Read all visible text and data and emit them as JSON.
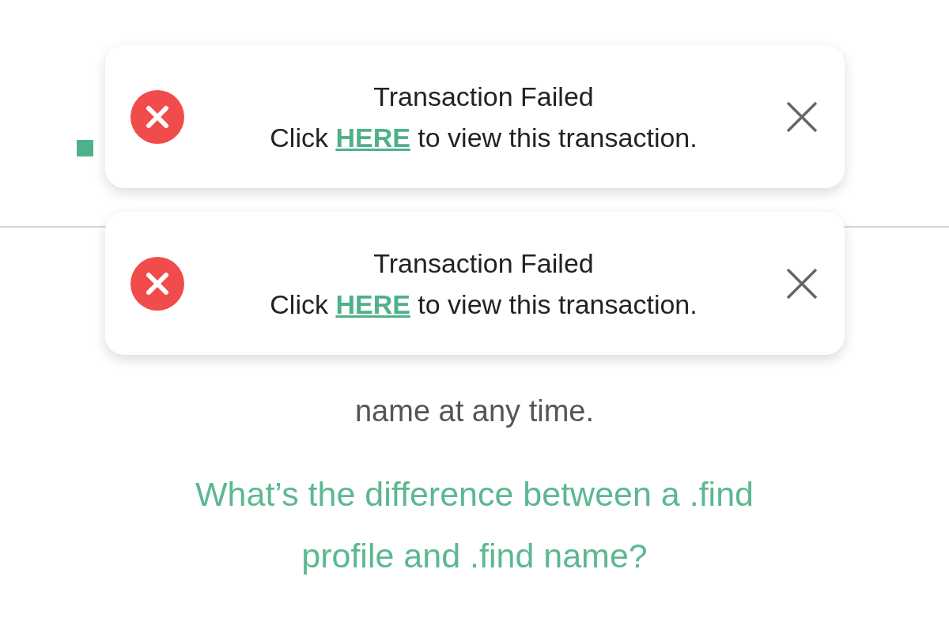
{
  "toasts": [
    {
      "title": "Transaction Failed",
      "link": "HERE",
      "before": "Click ",
      "after": " to view this transaction.",
      "kind": "error"
    },
    {
      "title": "Transaction Failed",
      "link": "HERE",
      "before": "Click ",
      "after": " to view this transaction.",
      "kind": "error"
    }
  ],
  "description": {
    "lines": [
      "name at any time."
    ]
  },
  "help_link": {
    "lines": [
      "What’s the difference between a .find",
      "profile and .find name?"
    ]
  }
}
